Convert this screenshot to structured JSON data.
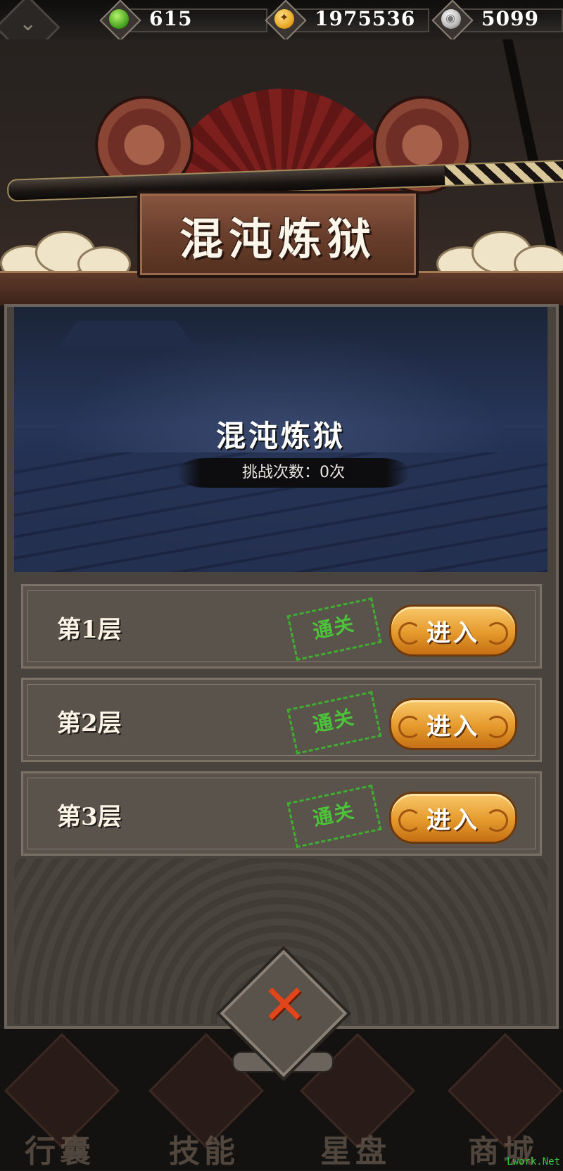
{
  "resources": [
    {
      "icon": "jade-icon",
      "value": "615"
    },
    {
      "icon": "gold-coin-icon",
      "value": "1975536"
    },
    {
      "icon": "silver-coin-icon",
      "value": "5099"
    }
  ],
  "header": {
    "title": "混沌炼狱"
  },
  "banner": {
    "title": "混沌炼狱",
    "challenge_count": "挑战次数：0次"
  },
  "floors": [
    {
      "label": "第1层",
      "status": "通关",
      "button": "进入"
    },
    {
      "label": "第2层",
      "status": "通关",
      "button": "进入"
    },
    {
      "label": "第3层",
      "status": "通关",
      "button": "进入"
    }
  ],
  "close": {
    "icon": "close-x-icon",
    "symbol": "✕"
  },
  "bottom_nav": [
    {
      "label": "行囊",
      "icon": "bag-icon"
    },
    {
      "label": "技能",
      "icon": "skill-icon"
    },
    {
      "label": "星盘",
      "icon": "star-chart-icon"
    },
    {
      "label": "商城",
      "icon": "shop-icon"
    }
  ],
  "watermark": "Lwork.Net",
  "colors": {
    "accent": "#e59a2c",
    "stamp": "#4cc43a",
    "close": "#e0461a"
  }
}
